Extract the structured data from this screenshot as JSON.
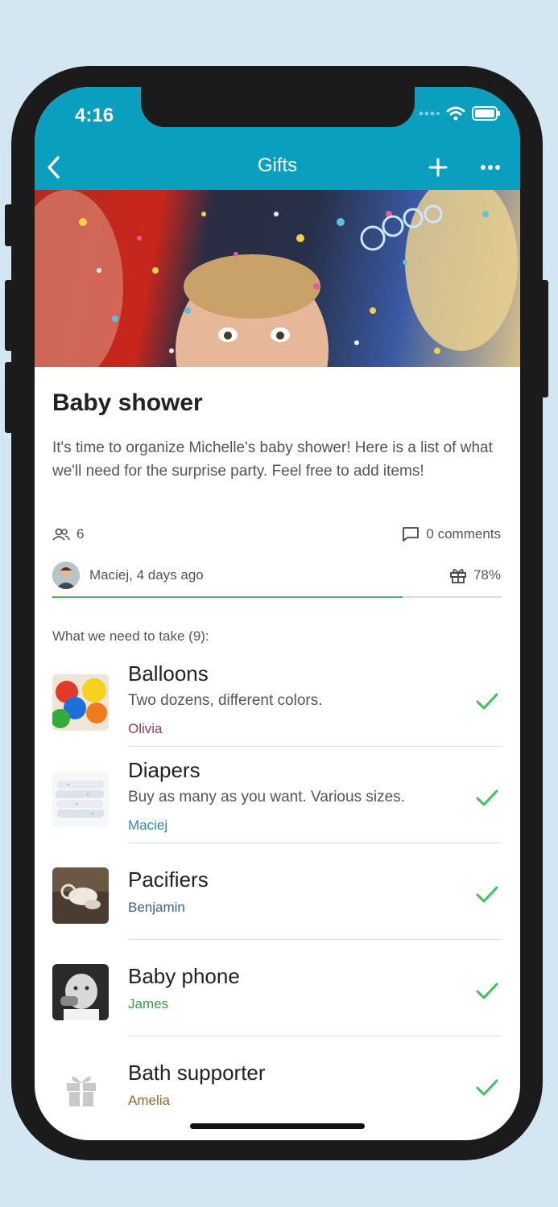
{
  "status": {
    "time": "4:16"
  },
  "nav": {
    "title": "Gifts"
  },
  "event": {
    "title": "Baby shower",
    "description": "It's time to organize Michelle's baby shower! Here is a list of what we'll need for the surprise party. Feel free to add items!",
    "participants": "6",
    "comments": "0 comments",
    "author": "Maciej, 4 days ago",
    "progress_label": "78%",
    "progress": 0.78,
    "section_label": "What we need to take (9):"
  },
  "items": [
    {
      "name": "Balloons",
      "desc": "Two dozens, different colors.",
      "who": "Olivia",
      "who_color": "#9b3a55"
    },
    {
      "name": "Diapers",
      "desc": "Buy as many as you want. Various sizes.",
      "who": "Maciej",
      "who_color": "#2e8c9a"
    },
    {
      "name": "Pacifiers",
      "desc": "",
      "who": "Benjamin",
      "who_color": "#3d5f8a"
    },
    {
      "name": "Baby phone",
      "desc": "",
      "who": "James",
      "who_color": "#3a9a52"
    },
    {
      "name": "Bath supporter",
      "desc": "",
      "who": "Amelia",
      "who_color": "#8a6a2e"
    }
  ],
  "colors": {
    "accent": "#0a9fbf",
    "check": "#3bc25a",
    "background": "#d5e6f3"
  },
  "icons": [
    "back-icon",
    "plus-icon",
    "more-icon",
    "people-icon",
    "comment-icon",
    "gift-icon",
    "check-icon",
    "wifi-icon",
    "battery-icon"
  ]
}
